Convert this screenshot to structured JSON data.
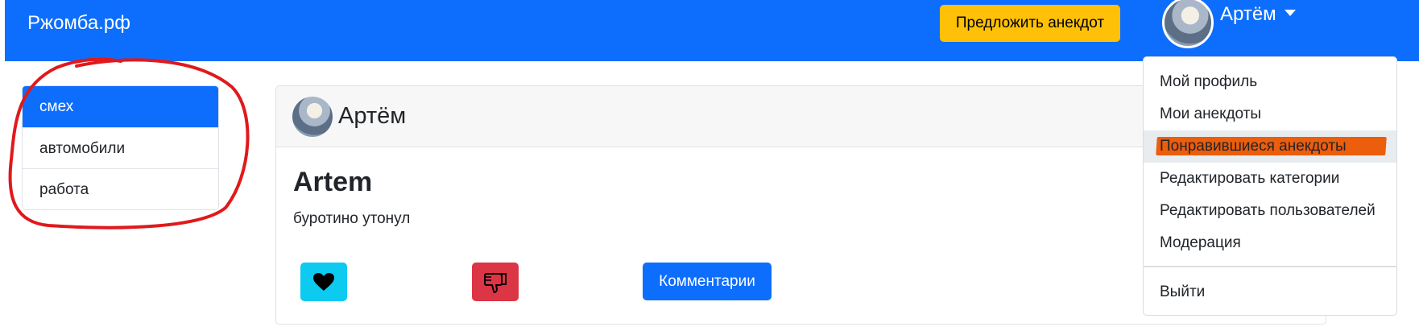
{
  "navbar": {
    "brand": "Ржомба.рф",
    "suggest_label": "Предложить анекдот",
    "user_name": "Артём"
  },
  "sidebar": {
    "categories": [
      {
        "label": "смех",
        "active": true
      },
      {
        "label": "автомобили",
        "active": false
      },
      {
        "label": "работа",
        "active": false
      }
    ]
  },
  "joke": {
    "author": "Артём",
    "title": "Artem",
    "text": "буротино утонул",
    "comments_label": "Комментарии"
  },
  "dropdown": {
    "items": [
      "Мой профиль",
      "Мои анекдоты",
      "Понравившиеся анекдоты",
      "Редактировать категории",
      "Редактировать пользователей",
      "Модерация"
    ],
    "logout": "Выйти"
  },
  "icons": {
    "like": "heart-icon",
    "dislike": "thumbs-down-icon",
    "caret": "caret-down-icon"
  },
  "colors": {
    "primary": "#0d6efd",
    "warning": "#ffc107",
    "info": "#0dcaf0",
    "danger": "#dc3545",
    "annotation_circle": "#e0191c",
    "annotation_highlight": "#ec5d0c"
  }
}
